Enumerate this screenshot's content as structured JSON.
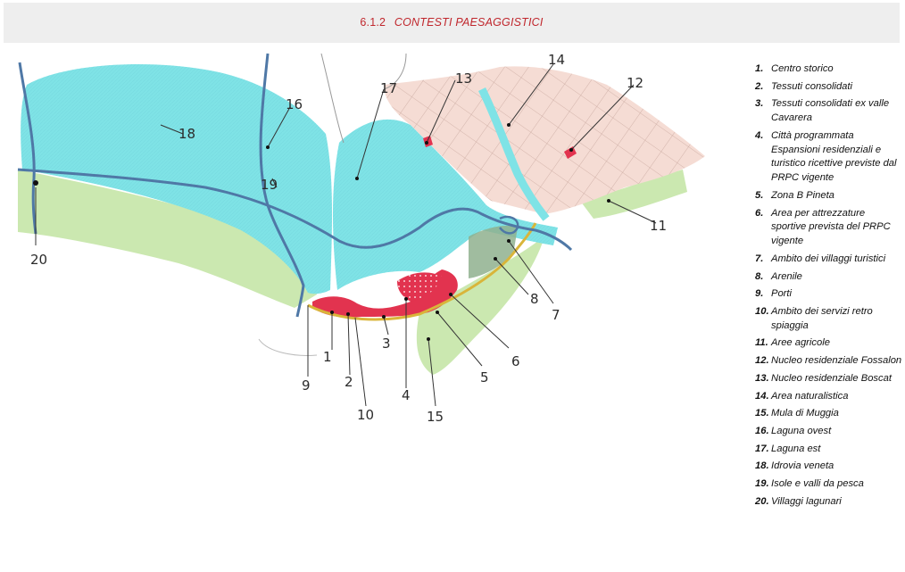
{
  "header": {
    "section_number": "6.1.2",
    "section_title": "CONTESTI PAESAGGISTICI"
  },
  "colors": {
    "laguna": "#7fe3e6",
    "agricolo": "#cbe8b0",
    "urban": "#f5dcd4",
    "centro": "#e2334f",
    "river": "#4f78a6",
    "arenile": "#d9b53a",
    "naturalistica": "#8fb08e"
  },
  "map": {
    "labels": [
      "1",
      "2",
      "3",
      "4",
      "5",
      "6",
      "7",
      "8",
      "9",
      "10",
      "11",
      "12",
      "13",
      "14",
      "15",
      "16",
      "17",
      "18",
      "19",
      "20"
    ]
  },
  "legend": [
    {
      "num": "1.",
      "text": "Centro storico"
    },
    {
      "num": "2.",
      "text": "Tessuti consolidati"
    },
    {
      "num": "3.",
      "text": "Tessuti consolidati ex valle Cavarera"
    },
    {
      "num": "4.",
      "text": "Città programmata Espansioni residenziali e turistico ricettive previste dal PRPC vigente"
    },
    {
      "num": "5.",
      "text": "Zona B Pineta"
    },
    {
      "num": "6.",
      "text": "Area per attrezzature sportive prevista del PRPC vigente"
    },
    {
      "num": "7.",
      "text": "Ambito dei villaggi turistici"
    },
    {
      "num": "8.",
      "text": "Arenile"
    },
    {
      "num": "9.",
      "text": "Porti"
    },
    {
      "num": "10.",
      "text": "Ambito dei servizi retro spiaggia"
    },
    {
      "num": "11.",
      "text": "Aree agricole"
    },
    {
      "num": "12.",
      "text": "Nucleo residenziale Fossalon"
    },
    {
      "num": "13.",
      "text": "Nucleo residenziale Boscat"
    },
    {
      "num": "14.",
      "text": "Area naturalistica"
    },
    {
      "num": "15.",
      "text": "Mula di Muggia"
    },
    {
      "num": "16.",
      "text": "Laguna ovest"
    },
    {
      "num": "17.",
      "text": "Laguna est"
    },
    {
      "num": "18.",
      "text": "Idrovia veneta"
    },
    {
      "num": "19.",
      "text": "Isole e valli da pesca"
    },
    {
      "num": "20.",
      "text": "Villaggi lagunari"
    }
  ]
}
